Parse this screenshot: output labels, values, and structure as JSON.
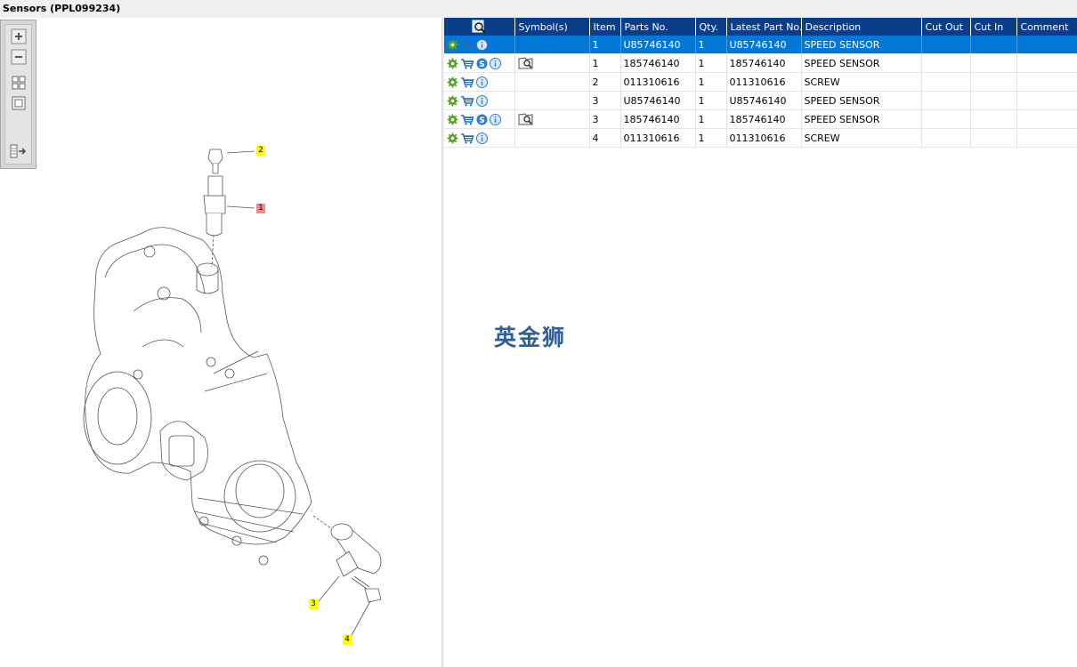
{
  "window": {
    "title": "Sensors (PPL099234)"
  },
  "toolbar": {
    "buttons": [
      {
        "name": "zoom-in-icon"
      },
      {
        "name": "zoom-out-icon"
      },
      {
        "name": "fit-grid-icon"
      },
      {
        "name": "actual-size-icon"
      },
      {
        "name": "toggle-panel-icon"
      }
    ]
  },
  "diagram": {
    "callouts": [
      {
        "label": "2",
        "color": "#ffff00"
      },
      {
        "label": "1",
        "color": "#f28a8a"
      },
      {
        "label": "3",
        "color": "#ffff00"
      },
      {
        "label": "4",
        "color": "#ffff00"
      }
    ]
  },
  "table": {
    "columns": [
      "",
      "Symbol(s)",
      "Item",
      "Parts No.",
      "Qty.",
      "Latest Part No.",
      "Description",
      "Cut Out",
      "Cut In",
      "Comment"
    ],
    "rows": [
      {
        "item": "1",
        "parts_no": "U85746140",
        "qty": "1",
        "latest": "U85746140",
        "description": "SPEED SENSOR",
        "icons": [
          "gear",
          "cart",
          "info"
        ],
        "symbol": false,
        "selected": true
      },
      {
        "item": "1",
        "parts_no": "185746140",
        "qty": "1",
        "latest": "185746140",
        "description": "SPEED SENSOR",
        "icons": [
          "gear",
          "cart",
          "s",
          "info"
        ],
        "symbol": true,
        "selected": false
      },
      {
        "item": "2",
        "parts_no": "011310616",
        "qty": "1",
        "latest": "011310616",
        "description": "SCREW",
        "icons": [
          "gear",
          "cart",
          "info"
        ],
        "symbol": false,
        "selected": false
      },
      {
        "item": "3",
        "parts_no": "U85746140",
        "qty": "1",
        "latest": "U85746140",
        "description": "SPEED SENSOR",
        "icons": [
          "gear",
          "cart",
          "info"
        ],
        "symbol": false,
        "selected": false
      },
      {
        "item": "3",
        "parts_no": "185746140",
        "qty": "1",
        "latest": "185746140",
        "description": "SPEED SENSOR",
        "icons": [
          "gear",
          "cart",
          "s",
          "info"
        ],
        "symbol": true,
        "selected": false
      },
      {
        "item": "4",
        "parts_no": "011310616",
        "qty": "1",
        "latest": "011310616",
        "description": "SCREW",
        "icons": [
          "gear",
          "cart",
          "info"
        ],
        "symbol": false,
        "selected": false
      }
    ]
  },
  "watermark": {
    "text": "英金狮"
  },
  "colors": {
    "header_bg": "#0a3d8a",
    "selected_row": "#0078d7",
    "gear": "#5aa02c",
    "cart": "#1f6fb8",
    "info": "#2f7fc9"
  }
}
